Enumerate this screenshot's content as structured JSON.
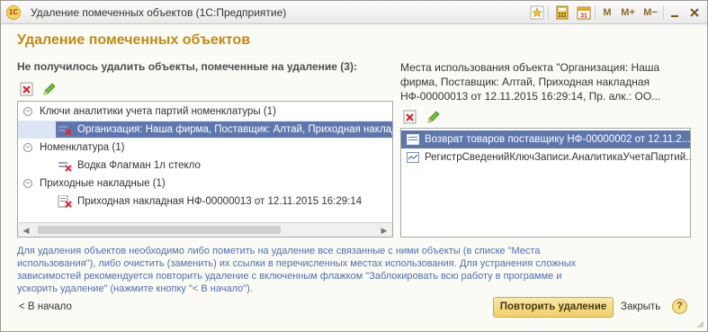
{
  "window": {
    "title": "Удаление помеченных объектов  (1С:Предприятие)",
    "logo_text": "1С",
    "toolbar": {
      "m_label": "M",
      "mplus_label": "M+",
      "mminus_label": "M−"
    }
  },
  "form": {
    "title": "Удаление помеченных объектов"
  },
  "left_panel": {
    "caption": "Не получилось удалить объекты, помеченные на удаление (3):",
    "tree": [
      {
        "level": 0,
        "text": "Ключи аналитики учета партий номенклатуры (1)",
        "expanded": true
      },
      {
        "level": 1,
        "text": "Организация: Наша фирма, Поставщик: Алтай, Приходная накладная",
        "selected": true,
        "icon": "marked-object-icon"
      },
      {
        "level": 0,
        "text": "Номенклатура (1)",
        "expanded": true
      },
      {
        "level": 1,
        "text": "Водка Флагман 1л стекло",
        "icon": "marked-object-icon"
      },
      {
        "level": 0,
        "text": "Приходные накладные (1)",
        "expanded": true
      },
      {
        "level": 1,
        "text": "Приходная накладная НФ-00000013 от 12.11.2015 16:29:14",
        "icon": "marked-document-icon"
      }
    ]
  },
  "right_panel": {
    "caption": "Места использования объекта \"Организация: Наша фирма, Поставщик: Алтай, Приходная накладная НФ-00000013 от 12.11.2015 16:29:14, Пр. алк.: ОО...",
    "items": [
      {
        "text": "Возврат товаров поставщику НФ-00000002 от 12.11.2...",
        "selected": true,
        "icon": "document-icon"
      },
      {
        "text": "РегистрСведенийКлючЗаписи.АналитикаУчетаПартий...",
        "icon": "register-icon"
      }
    ]
  },
  "hint": "Для удаления объектов необходимо либо пометить на удаление все связанные с ними объекты (в списке \"Места использования\"), либо очистить (заменить) их ссылки в перечисленных местах использования. Для устранения сложных зависимостей рекомендуется повторить удаление с включенным флажком \"Заблокировать всю работу в программе и ускорить удаление\" (нажмите кнопку \"< В начало\").",
  "footer": {
    "back_label": "< В начало",
    "repeat_label": "Повторить удаление",
    "close_label": "Закрыть",
    "help_label": "?"
  },
  "colors": {
    "accent_title": "#c28a14",
    "selection": "#5d77ad",
    "hint_text": "#4f6eb0",
    "primary_button": "#f1cf66"
  }
}
